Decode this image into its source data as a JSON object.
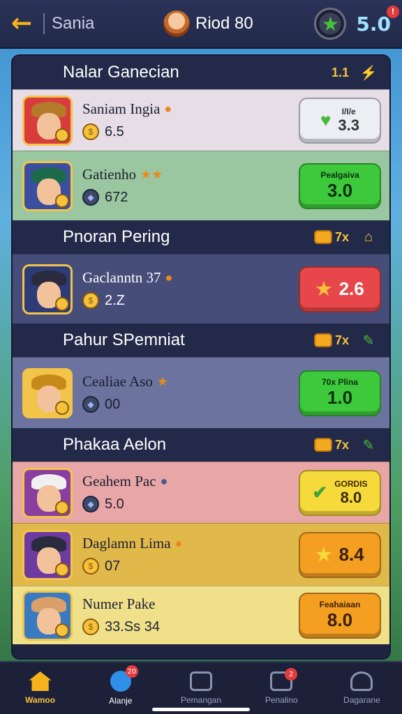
{
  "header": {
    "back_label": "←",
    "title": "Sania",
    "round": "Riod 80",
    "coins": "5.0",
    "coins_badge": "!"
  },
  "sections": [
    {
      "title": "Nalar Ganecian",
      "badge": "1.1",
      "rows": [
        {
          "name": "Saniam Ingia",
          "stat": "6.5",
          "btn_top": "I/I/e",
          "btn_value": "3.3"
        },
        {
          "name": "Gatienho",
          "stat": "672",
          "btn_top": "Pealgaiva",
          "btn_value": "3.0"
        }
      ]
    },
    {
      "title": "Pnoran Pering",
      "badge": "7x",
      "rows": [
        {
          "name": "Gaclanntn 37",
          "stat": "2.Z",
          "btn_top": "",
          "btn_value": "2.6"
        }
      ]
    },
    {
      "title": "Pahur SPemniat",
      "badge": "7x",
      "rows": [
        {
          "name": "Cealiae Aso",
          "stat": "00",
          "btn_top": "70x Plina",
          "btn_value": "1.0"
        }
      ]
    },
    {
      "title": "Phakaa Aelon",
      "badge": "7x",
      "rows": [
        {
          "name": "Geahem Pac",
          "stat": "5.0",
          "btn_top": "GORDIS",
          "btn_value": "8.0"
        },
        {
          "name": "Daglamn Lima",
          "stat": "07",
          "btn_top": "",
          "btn_value": "8.4"
        },
        {
          "name": "Numer Pake",
          "stat": "33.Ss 34",
          "btn_top": "Feahaiaan",
          "btn_value": "8.0"
        }
      ]
    }
  ],
  "nav": [
    {
      "label": "Wamoo",
      "badge": ""
    },
    {
      "label": "Alanje",
      "badge": "20"
    },
    {
      "label": "Pemangan",
      "badge": ""
    },
    {
      "label": "Penalino",
      "badge": "2"
    },
    {
      "label": "Dagarane",
      "badge": ""
    }
  ],
  "colors": {
    "accent": "#f6c23b",
    "green_button": "#3ec93d",
    "red_button": "#e7474a",
    "yellow_button": "#f6d93a",
    "orange_button": "#f59f22"
  }
}
